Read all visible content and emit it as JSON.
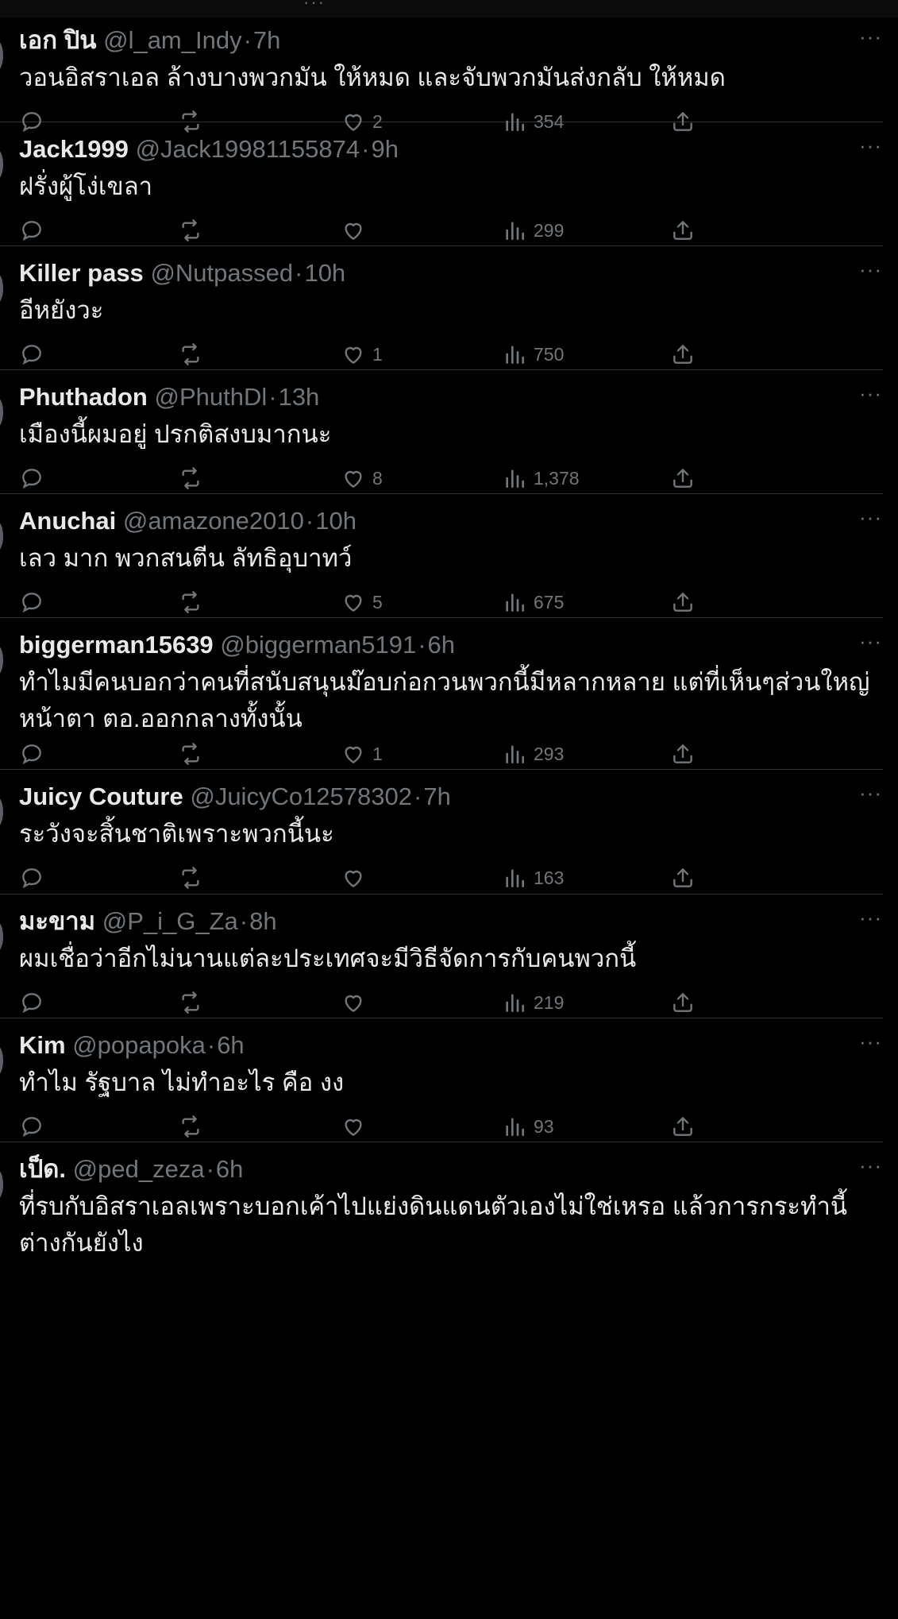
{
  "top_bar": {
    "dots": "···",
    "caret": "⌃"
  },
  "tweets": [
    {
      "name": "เอก ปิน",
      "handle": "@l_am_Indy",
      "time": "7h",
      "text": "วอนอิสราเอล ล้างบางพวกมัน ให้หมด และจับพวกมันส่งกลับ ให้หมด",
      "likes": "2",
      "views": "354"
    },
    {
      "name": "Jack1999",
      "handle": "@Jack19981155874",
      "time": "9h",
      "text": "ฝรั่งผู้โง่เขลา",
      "likes": "",
      "views": "299"
    },
    {
      "name": "Killer pass",
      "handle": "@Nutpassed",
      "time": "10h",
      "text": "อีหยังวะ",
      "likes": "1",
      "views": "750"
    },
    {
      "name": "Phuthadon",
      "handle": "@PhuthDl",
      "time": "13h",
      "text": "เมืองนี้ผมอยู่ ปรกติสงบมากนะ",
      "likes": "8",
      "views": "1,378"
    },
    {
      "name": "Anuchai",
      "handle": "@amazone2010",
      "time": "10h",
      "text": "เลว มาก พวกสนตีน ลัทธิอุบาทว์",
      "likes": "5",
      "views": "675"
    },
    {
      "name": "biggerman15639",
      "handle": "@biggerman5191",
      "time": "6h",
      "text": "ทำไมมีคนบอกว่าคนที่สนับสนุนม๊อบก่อกวนพวกนี้มีหลากหลาย แต่ที่เห็นๆส่วนใหญ่หน้าตา ตอ.ออกกลางทั้งนั้น",
      "likes": "1",
      "views": "293"
    },
    {
      "name": "Juicy Couture",
      "handle": "@JuicyCo12578302",
      "time": "7h",
      "text": "ระวังจะสิ้นชาติเพราะพวกนี้นะ",
      "likes": "",
      "views": "163"
    },
    {
      "name": "มะขาม",
      "handle": "@P_i_G_Za",
      "time": "8h",
      "text": "ผมเชื่อว่าอีกไม่นานแต่ละประเทศจะมีวิธีจัดการกับคนพวกนี้",
      "likes": "",
      "views": "219"
    },
    {
      "name": "Kim",
      "handle": "@popapoka",
      "time": "6h",
      "text": "ทำไม รัฐบาล ไม่ทำอะไร คือ งง",
      "likes": "",
      "views": "93"
    },
    {
      "name": "เป็ด.",
      "handle": "@ped_zeza",
      "time": "6h",
      "text": "ที่รบกับอิสราเอลเพราะบอกเค้าไปแย่งดินแดนตัวเองไม่ใช่เหรอ แล้วการกระทำนี้ต่างกันยังไง",
      "likes": "",
      "views": ""
    }
  ],
  "labels": {
    "dot": "·",
    "more": "···"
  },
  "icons": {
    "reply": "reply-icon",
    "retweet": "retweet-icon",
    "like": "heart-icon",
    "views": "views-chart-icon",
    "share": "share-icon"
  },
  "colors": {
    "background": "#000000",
    "text": "#e7e9ea",
    "secondary": "#71767b",
    "divider": "#2f3336"
  }
}
